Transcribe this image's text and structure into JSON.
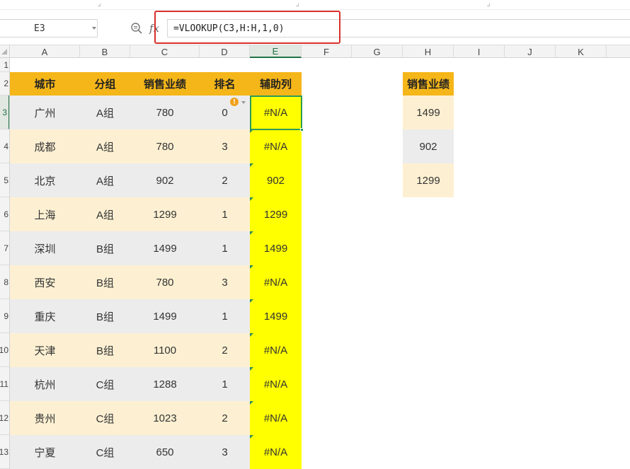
{
  "formula_bar": {
    "name_box": "E3",
    "formula": "=VLOOKUP(C3,H:H,1,0)"
  },
  "columns": [
    "A",
    "B",
    "C",
    "D",
    "E",
    "F",
    "G",
    "H",
    "I",
    "J",
    "K"
  ],
  "rows": [
    "1",
    "2",
    "3",
    "4",
    "5",
    "6",
    "7",
    "8",
    "9",
    "10",
    "11",
    "12",
    "13"
  ],
  "active_cell": {
    "column": "E",
    "row": "3"
  },
  "main_table": {
    "headers": [
      "城市",
      "分组",
      "销售业绩",
      "排名",
      "辅助列"
    ],
    "rows": [
      [
        "广州",
        "A组",
        "780",
        "0",
        "#N/A"
      ],
      [
        "成都",
        "A组",
        "780",
        "3",
        "#N/A"
      ],
      [
        "北京",
        "A组",
        "902",
        "2",
        "902"
      ],
      [
        "上海",
        "A组",
        "1299",
        "1",
        "1299"
      ],
      [
        "深圳",
        "B组",
        "1499",
        "1",
        "1499"
      ],
      [
        "西安",
        "B组",
        "780",
        "3",
        "#N/A"
      ],
      [
        "重庆",
        "B组",
        "1499",
        "1",
        "1499"
      ],
      [
        "天津",
        "B组",
        "1100",
        "2",
        "#N/A"
      ],
      [
        "杭州",
        "C组",
        "1288",
        "1",
        "#N/A"
      ],
      [
        "贵州",
        "C组",
        "1023",
        "2",
        "#N/A"
      ],
      [
        "宁夏",
        "C组",
        "650",
        "3",
        "#N/A"
      ]
    ]
  },
  "lookup_table": {
    "header": "销售业绩",
    "values": [
      "1499",
      "902",
      "1299"
    ]
  },
  "colors": {
    "header_fill": "#f5b619",
    "band_gray": "#ececec",
    "band_cream": "#fdf0d2",
    "helper_fill": "#ffff00",
    "highlight_border": "#d9302c",
    "selection": "#2e9b58",
    "warning": "#f0a21a"
  },
  "icons": {
    "zoom": "zoom-formula-icon",
    "fx": "fx-icon",
    "warning": "error-warning-icon"
  }
}
